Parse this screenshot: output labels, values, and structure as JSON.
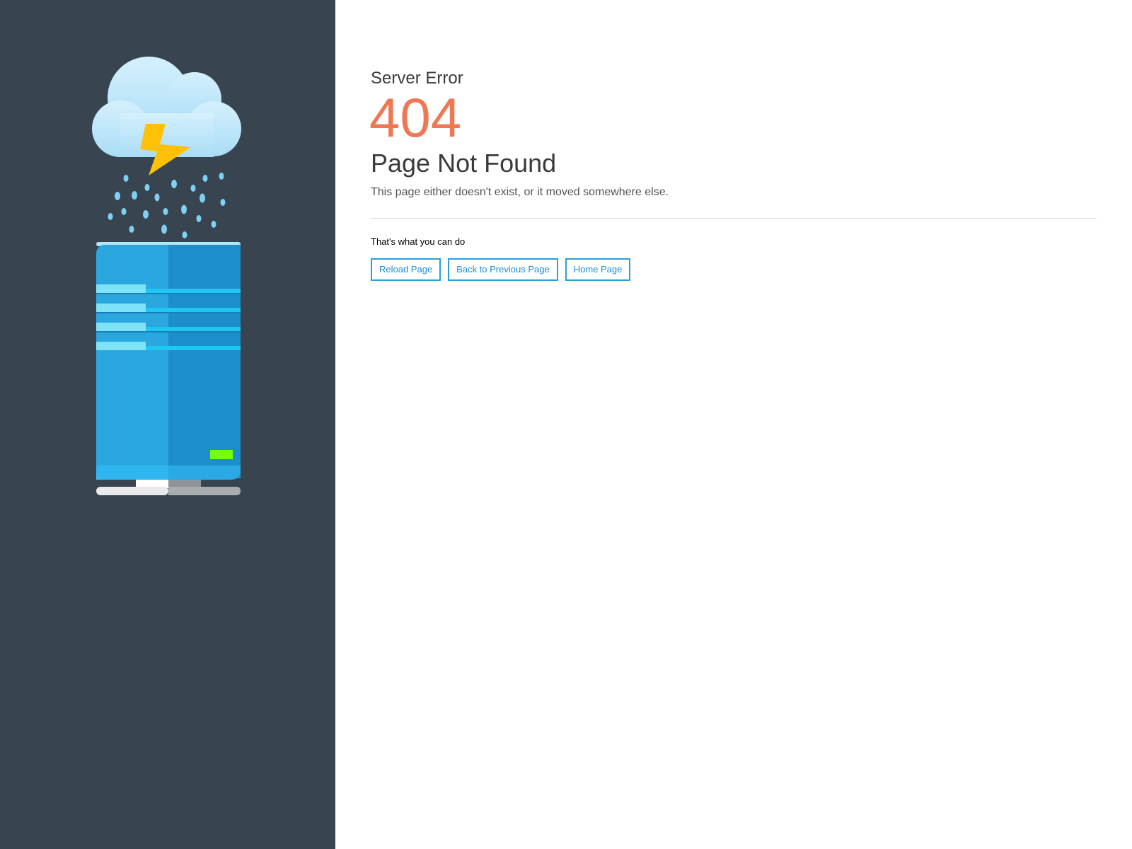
{
  "eyebrow": "Server Error",
  "error_code": "404",
  "headline": "Page Not Found",
  "description": "This page either doesn't exist, or it moved somewhere else.",
  "actions": {
    "heading": "That's what you can do",
    "buttons": [
      {
        "label": "Reload Page"
      },
      {
        "label": "Back to Previous Page"
      },
      {
        "label": "Home Page"
      }
    ]
  },
  "colors": {
    "sidebar": "#38444f",
    "accent": "#ee7853",
    "button": "#2a9fd8"
  },
  "illustration_icon": "server-rain-cloud-illustration"
}
